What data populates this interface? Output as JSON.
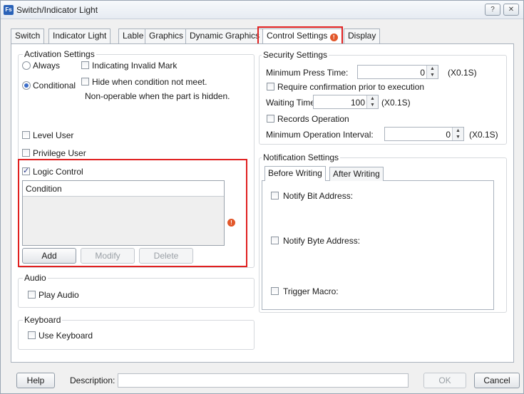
{
  "window": {
    "title": "Switch/Indicator Light",
    "app_icon_text": "Fs",
    "help_glyph": "?",
    "close_glyph": "✕"
  },
  "tabs": [
    {
      "label": "Switch"
    },
    {
      "label": "Indicator Light"
    },
    {
      "label": "Lable"
    },
    {
      "label": "Graphics"
    },
    {
      "label": "Dynamic Graphics"
    },
    {
      "label": "Control Settings"
    },
    {
      "label": "Display"
    }
  ],
  "activation": {
    "title": "Activation Settings",
    "always_label": "Always",
    "conditional_label": "Conditional",
    "selected": "Conditional",
    "indicating_invalid_mark": {
      "label": "Indicating Invalid Mark",
      "checked": false
    },
    "hide_when": {
      "label": "Hide when condition not meet.",
      "checked": false
    },
    "hide_note": "Non-operable when the part is hidden.",
    "level_user": {
      "label": "Level User",
      "checked": false
    },
    "privilege_user": {
      "label": "Privilege User",
      "checked": false
    },
    "logic_control": {
      "label": "Logic Control",
      "checked": true
    },
    "condition_header": "Condition",
    "buttons": {
      "add": "Add",
      "modify": "Modify",
      "delete": "Delete"
    }
  },
  "audio": {
    "title": "Audio",
    "play_audio": {
      "label": "Play Audio",
      "checked": false
    }
  },
  "keyboard": {
    "title": "Keyboard",
    "use_keyboard": {
      "label": "Use Keyboard",
      "checked": false
    }
  },
  "security": {
    "title": "Security Settings",
    "min_press_label": "Minimum Press Time:",
    "min_press_value": "0",
    "min_press_unit": "(X0.1S)",
    "require_confirm": {
      "label": "Require confirmation prior to execution",
      "checked": false
    },
    "waiting_label": "Waiting Time",
    "waiting_value": "100",
    "waiting_unit": "(X0.1S)",
    "records_operation": {
      "label": "Records Operation",
      "checked": false
    },
    "min_interval_label": "Minimum Operation Interval:",
    "min_interval_value": "0",
    "min_interval_unit": "(X0.1S)"
  },
  "notification": {
    "title": "Notification Settings",
    "subtabs": [
      "Before Writing",
      "After Writing"
    ],
    "notify_bit": {
      "label": "Notify Bit Address:",
      "checked": false
    },
    "notify_byte": {
      "label": "Notify Byte Address:",
      "checked": false
    },
    "trigger_macro": {
      "label": "Trigger Macro:",
      "checked": false
    }
  },
  "footer": {
    "help": "Help",
    "description_label": "Description:",
    "description_value": "",
    "ok": "OK",
    "cancel": "Cancel"
  },
  "warn_glyph": "!",
  "colors": {
    "highlight": "#e02020",
    "warning": "#e2572a",
    "radio_selected": "#3a6cc8"
  }
}
